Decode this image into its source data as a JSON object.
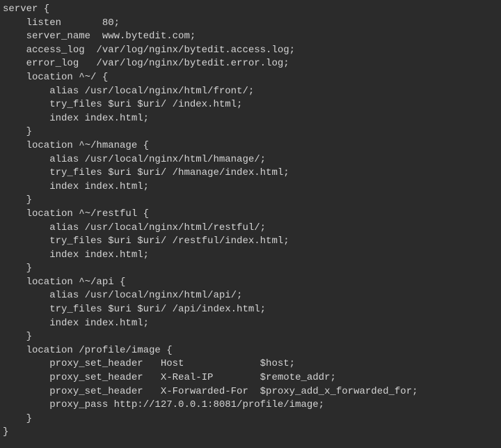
{
  "code": {
    "lines": [
      "server {",
      "    listen       80;",
      "    server_name  www.bytedit.com;",
      "    access_log  /var/log/nginx/bytedit.access.log;",
      "    error_log   /var/log/nginx/bytedit.error.log;",
      "",
      "    location ^~/ {",
      "        alias /usr/local/nginx/html/front/;",
      "        try_files $uri $uri/ /index.html;",
      "        index index.html;",
      "    }",
      "    location ^~/hmanage {",
      "        alias /usr/local/nginx/html/hmanage/;",
      "        try_files $uri $uri/ /hmanage/index.html;",
      "        index index.html;",
      "    }",
      "    location ^~/restful {",
      "        alias /usr/local/nginx/html/restful/;",
      "        try_files $uri $uri/ /restful/index.html;",
      "        index index.html;",
      "    }",
      "    location ^~/api {",
      "        alias /usr/local/nginx/html/api/;",
      "        try_files $uri $uri/ /api/index.html;",
      "        index index.html;",
      "    }",
      "    location /profile/image {",
      "        proxy_set_header   Host             $host;",
      "        proxy_set_header   X-Real-IP        $remote_addr;",
      "        proxy_set_header   X-Forwarded-For  $proxy_add_x_forwarded_for;",
      "        proxy_pass http://127.0.0.1:8081/profile/image;",
      "    }",
      "}"
    ]
  }
}
